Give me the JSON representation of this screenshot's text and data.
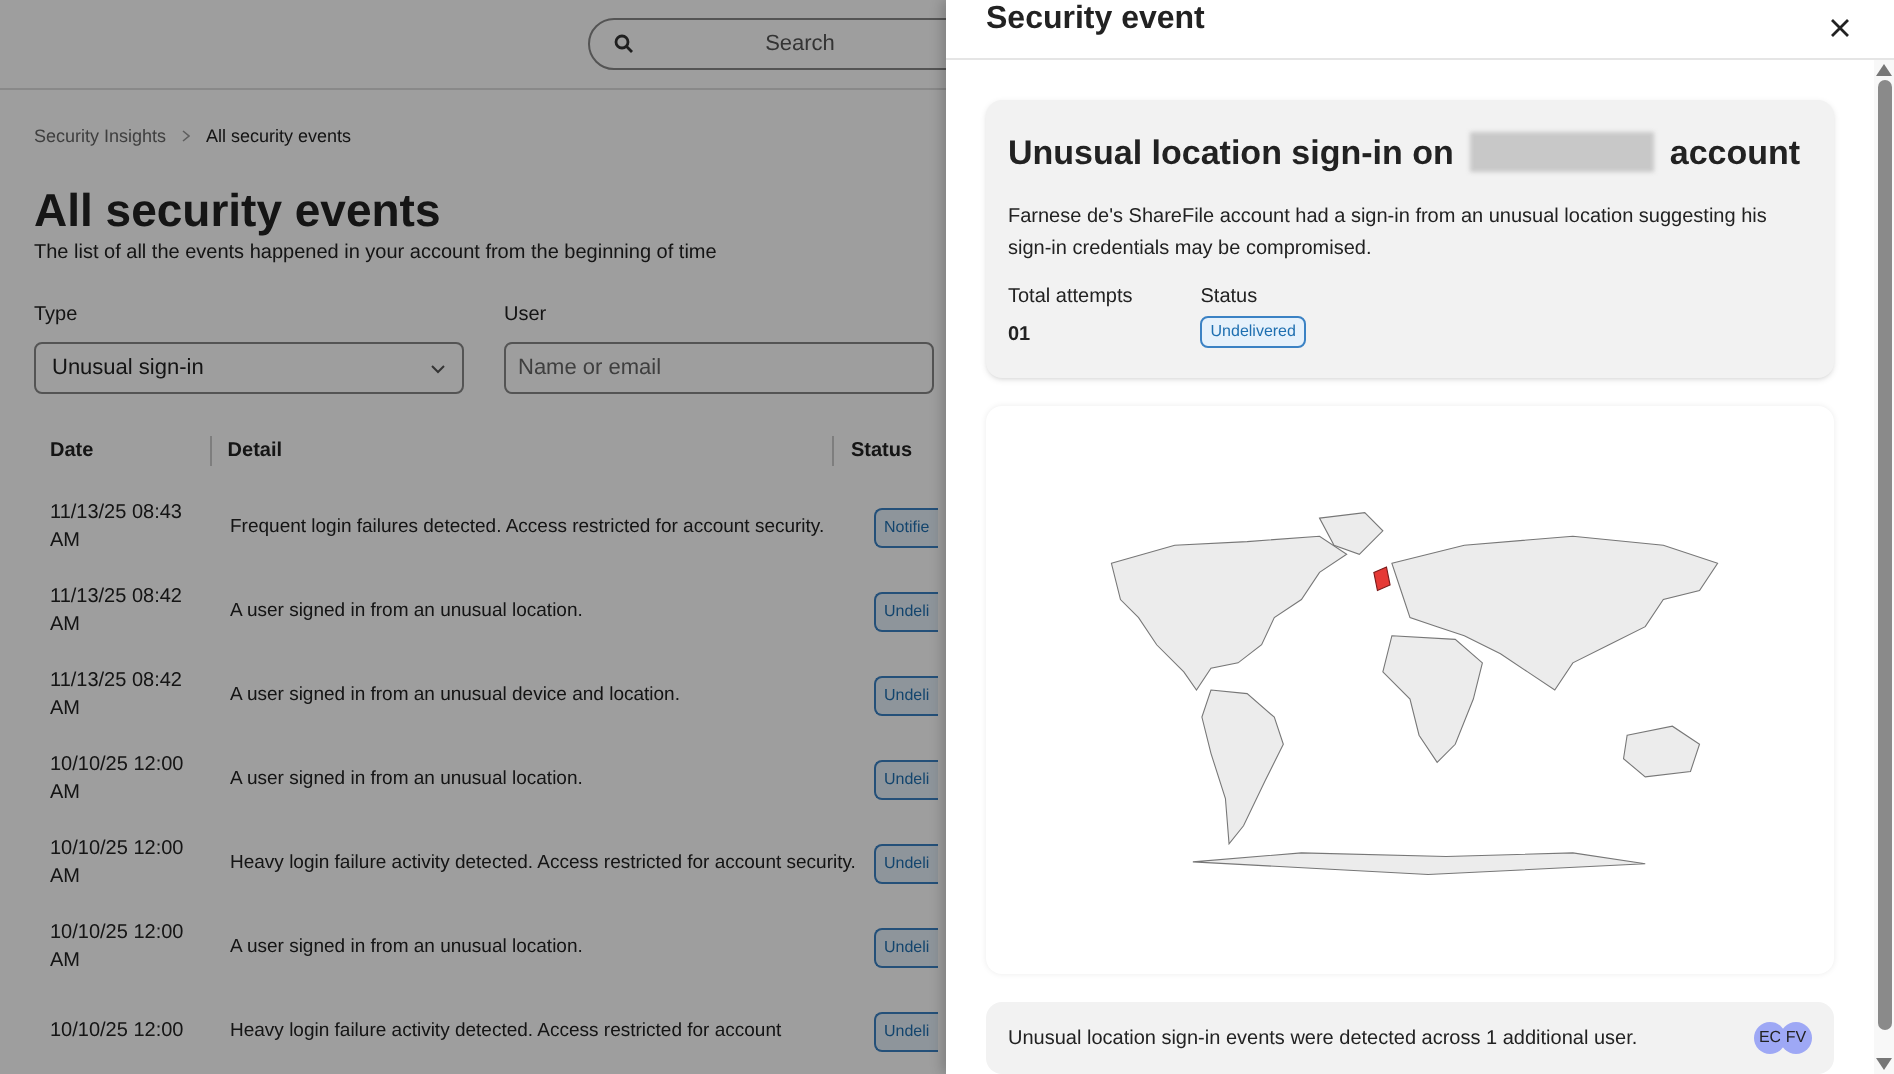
{
  "header": {
    "search": {
      "placeholder": "Search"
    }
  },
  "breadcrumb": [
    "Security Insights",
    "All security events"
  ],
  "page": {
    "title": "All security events",
    "subtitle": "The list of all the events happened in your account from the beginning of time"
  },
  "filters": {
    "type": {
      "label": "Type",
      "value": "Unusual sign-in"
    },
    "user": {
      "label": "User",
      "placeholder": "Name or email"
    }
  },
  "table": {
    "columns": [
      "Date",
      "Detail",
      "Status"
    ],
    "rows": [
      {
        "date": "11/13/25 08:43 AM",
        "detail": "Frequent login failures detected. Access restricted for account security.",
        "status": "Notifie"
      },
      {
        "date": "11/13/25 08:42 AM",
        "detail": "A user signed in from an unusual location.",
        "status": "Undeli"
      },
      {
        "date": "11/13/25 08:42 AM",
        "detail": "A user signed in from an unusual device and location.",
        "status": "Undeli"
      },
      {
        "date": "10/10/25 12:00 AM",
        "detail": "A user signed in from an unusual location.",
        "status": "Undeli"
      },
      {
        "date": "10/10/25 12:00 AM",
        "detail": "Heavy login failure activity detected. Access restricted for account security.",
        "status": "Undeli"
      },
      {
        "date": "10/10/25 12:00 AM",
        "detail": "A user signed in from an unusual location.",
        "status": "Undeli"
      },
      {
        "date": "10/10/25 12:00",
        "detail": "Heavy login failure activity detected. Access restricted for account",
        "status": "Undeli"
      }
    ]
  },
  "panel": {
    "title": "Security event",
    "event": {
      "title_start": "Unusual location sign-in on",
      "title_end": "account",
      "description": "Farnese de's ShareFile account had a sign-in from an unusual location suggesting his sign-in credentials may be compromised.",
      "attempts_label": "Total attempts",
      "attempts": "01",
      "status_label": "Status",
      "status": "Undelivered"
    },
    "footer": {
      "text": "Unusual location sign-in events were detected across 1 additional user.",
      "avatars": [
        {
          "initials": "EC"
        },
        {
          "initials": "FV"
        }
      ]
    }
  }
}
